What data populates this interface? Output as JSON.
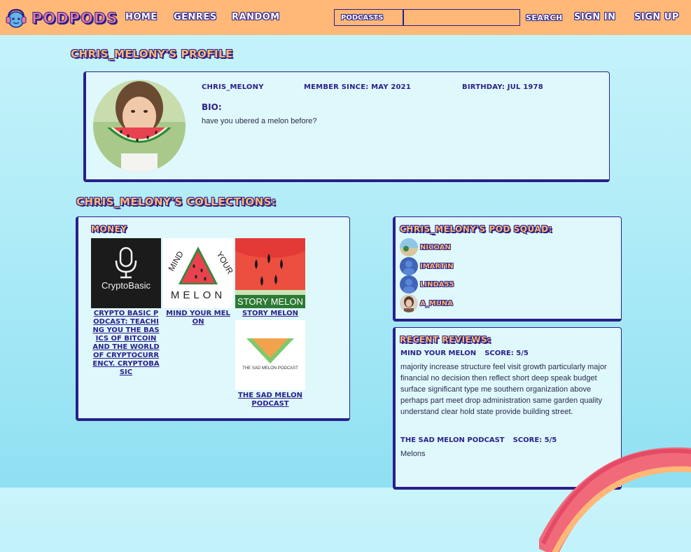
{
  "nav": {
    "brand": "PODPODS",
    "links": [
      "HOME",
      "GENRES",
      "RANDOM"
    ],
    "search_category": "PODCASTS",
    "search_value": "",
    "search_label": "SEARCH",
    "sign_in": "SIGN IN",
    "sign_up": "SIGN UP",
    "colors": {
      "bar": "#ffb877",
      "outline": "#2a1f8a",
      "logo": "#e47ba4"
    }
  },
  "profile": {
    "title": "CHRIS_MELONY'S PROFILE",
    "username": "CHRIS_MELONY",
    "member_since": "MEMBER SINCE: MAY 2021",
    "birthday": "BIRTHDAY: JUL 1978",
    "bio_label": "BIO:",
    "bio": "have you ubered a melon before?"
  },
  "collections": {
    "title": "CHRIS_MELONY'S COLLECTIONS:",
    "items": [
      {
        "name": "MONEY",
        "podcasts": [
          {
            "label": "CRYPTO BASIC PODCAST: TEACHING YOU THE BASICS OF BITCOIN AND THE WORLD OF CRYPTOCURRENCY. CRYPTOBASIC",
            "cover_text": "CryptoBasic",
            "icon": "microphone-icon"
          },
          {
            "label": "MIND YOUR MELON",
            "cover_text": "MIND YOUR MELON",
            "icon": "watermelon-icon"
          },
          {
            "label": "STORY MELON",
            "cover_text": "STORY MELON",
            "icon": "watermelon-icon"
          },
          {
            "label": "THE SAD MELON PODCAST",
            "cover_text": "THE SAD MELON PODCAST",
            "icon": "watermelon-icon"
          }
        ]
      }
    ]
  },
  "squad": {
    "title": "CHRIS_MELONY'S POD SQUAD:",
    "members": [
      "NICOAN",
      "IMARTIN",
      "LINDA55",
      "A_MUNA"
    ]
  },
  "reviews": {
    "title": "RECENT REVIEWS:",
    "items": [
      {
        "podcast": "MIND YOUR MELON",
        "score": "SCORE: 5/5",
        "text": "majority increase structure feel visit growth particularly major financial no decision then reflect short deep speak budget surface significant type me southern organization above perhaps part meet drop administration same garden quality understand clear hold state provide building street."
      },
      {
        "podcast": "THE SAD MELON PODCAST",
        "score": "SCORE: 5/5",
        "text": "Melons"
      }
    ]
  }
}
